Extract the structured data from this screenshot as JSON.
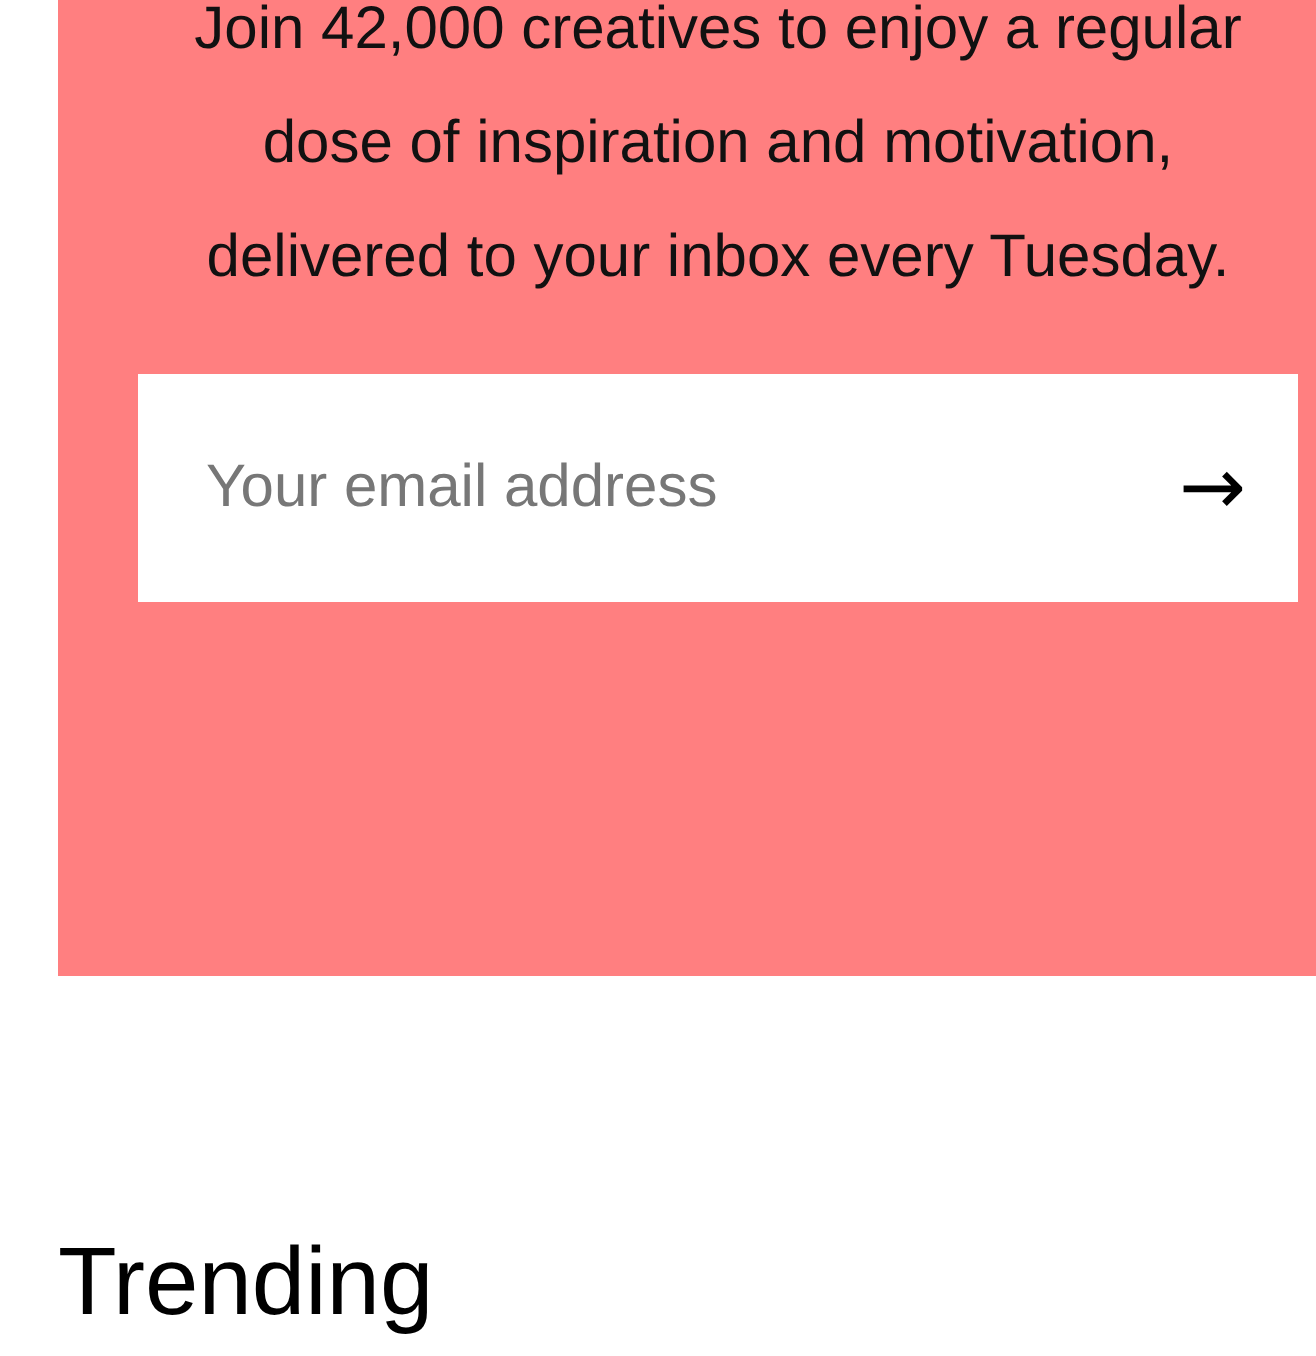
{
  "newsletter": {
    "text": "Join 42,000 creatives to enjoy a regular dose of inspiration and motivation, delivered to your inbox every Tuesday.",
    "email": {
      "placeholder": "Your email address",
      "submit": "→"
    }
  },
  "section_heading": "Trending"
}
